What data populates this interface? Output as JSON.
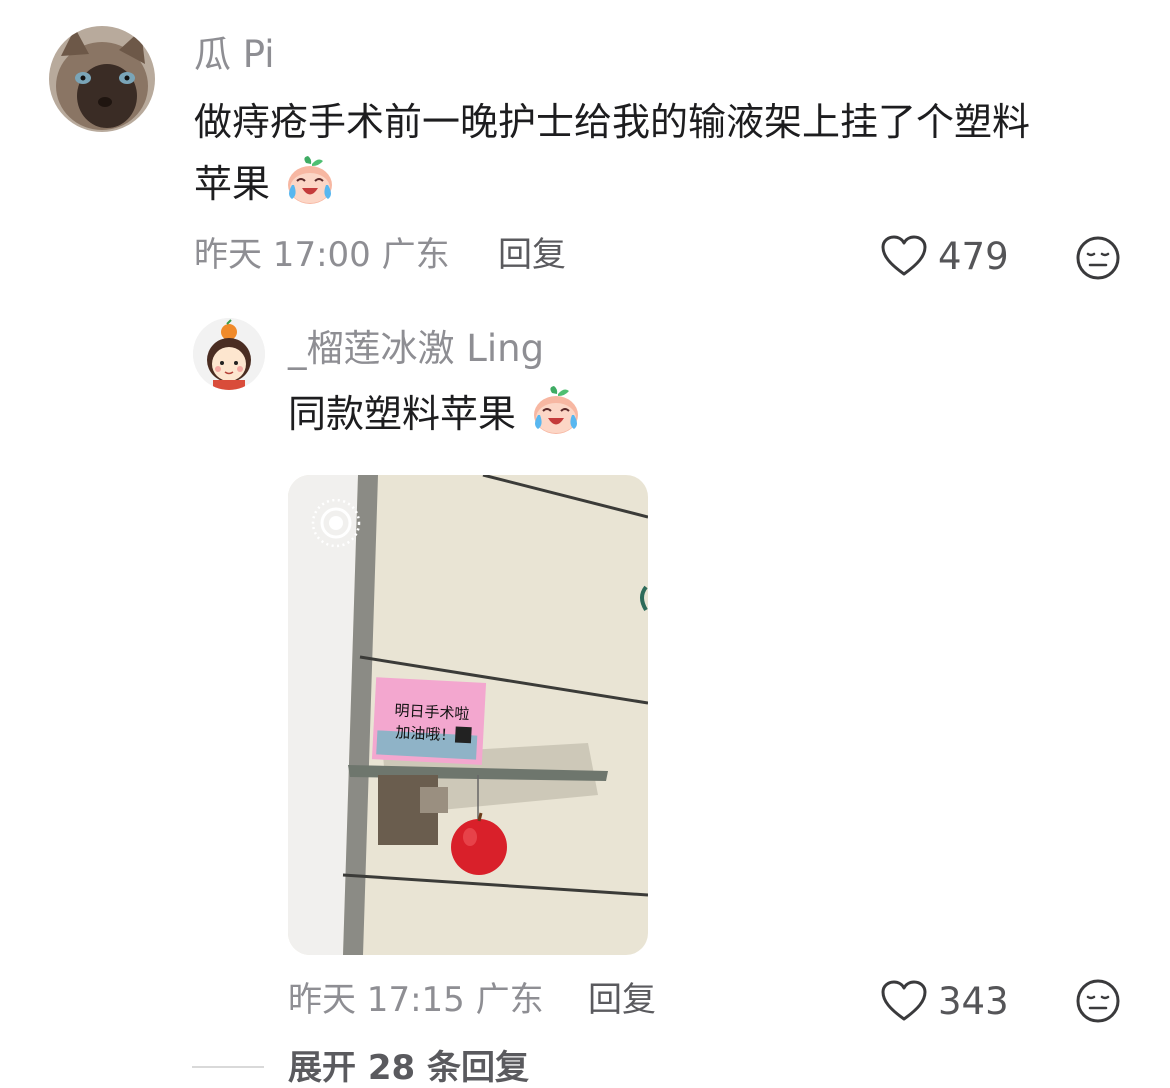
{
  "comment1": {
    "username": "瓜 Pi",
    "text_line1": "做痔疮手术前一晚护士给我的输液架上挂了个塑料",
    "text_line2": "苹果",
    "time": "昨天 17:00 广东",
    "reply_label": "回复",
    "likes": "479"
  },
  "comment2": {
    "username": "_榴莲冰激 Ling",
    "text": "同款塑料苹果",
    "image": {
      "sign_line1": "明日手术啦",
      "sign_line2": "加油哦！"
    },
    "time": "昨天 17:15 广东",
    "reply_label": "回复",
    "likes": "343"
  },
  "expand": {
    "label": "展开 28 条回复"
  },
  "colors": {
    "meta_gray": "#8e8e93",
    "apple_red": "#d9202a",
    "sign_pink": "#f3a7cf"
  },
  "icons": [
    "heart-icon",
    "meh-face-icon",
    "crying-peach-emoji",
    "live-photo-icon"
  ]
}
